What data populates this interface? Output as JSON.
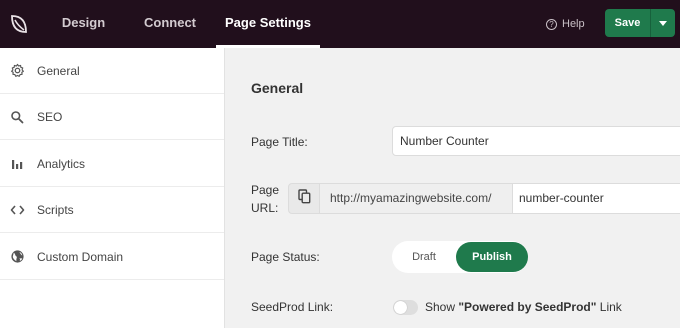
{
  "header": {
    "tabs": [
      {
        "label": "Design"
      },
      {
        "label": "Connect"
      },
      {
        "label": "Page Settings",
        "active": true
      }
    ],
    "help_label": "Help",
    "save_label": "Save",
    "accent_color": "#1f7a4c",
    "background_color": "#210f1c"
  },
  "sidebar": {
    "items": [
      {
        "label": "General",
        "icon": "gear-icon"
      },
      {
        "label": "SEO",
        "icon": "search-icon"
      },
      {
        "label": "Analytics",
        "icon": "bar-chart-icon"
      },
      {
        "label": "Scripts",
        "icon": "code-icon"
      },
      {
        "label": "Custom Domain",
        "icon": "globe-icon"
      }
    ]
  },
  "main": {
    "section_title": "General",
    "page_title_label": "Page Title:",
    "page_title_value": "Number Counter",
    "page_url_label_line1": "Page",
    "page_url_label_line2": "URL:",
    "page_url_base": "http://myamazingwebsite.com/",
    "page_url_slug": "number-counter",
    "page_status_label": "Page Status:",
    "status_draft": "Draft",
    "status_publish": "Publish",
    "status_selected": "Publish",
    "seedprod_link_label": "SeedProd Link:",
    "seedprod_show": "Show ",
    "seedprod_powered": "\"Powered by SeedProd\"",
    "seedprod_link_word": " Link",
    "seedprod_link_enabled": false
  }
}
